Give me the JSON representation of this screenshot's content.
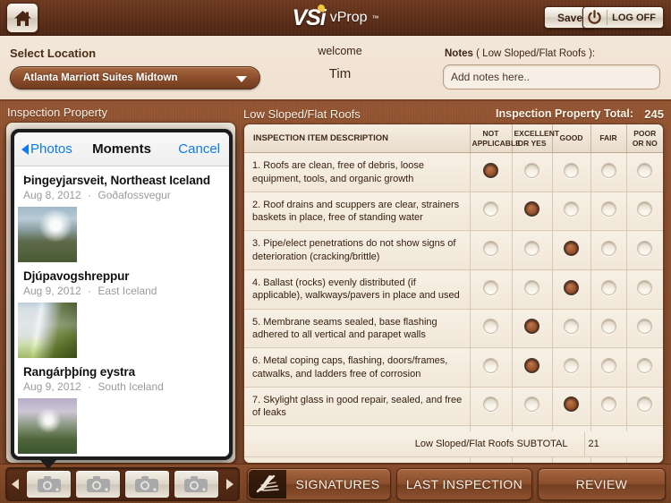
{
  "topbar": {
    "home_icon": "home-icon",
    "logo_primary": "VSi",
    "logo_secondary": "vProp",
    "logo_tm": "™",
    "save_label": "Save",
    "logoff_label": "LOG OFF",
    "power_icon": "power-icon"
  },
  "subbar": {
    "select_location_label": "Select Location",
    "location_value": "Atlanta Marriott Suites Midtown",
    "welcome_label": "welcome",
    "welcome_name": "Tim",
    "notes_label_prefix": "Notes",
    "notes_label_section": "( Low Sloped/Flat Roofs ):",
    "notes_placeholder": "Add notes here..",
    "notes_value": ""
  },
  "panels": {
    "left_title": "Inspection Property",
    "right_title": "Low Sloped/Flat Roofs",
    "total_label": "Inspection Property Total:",
    "total_value": "245"
  },
  "photo_picker": {
    "back_label": "Photos",
    "title": "Moments",
    "cancel_label": "Cancel",
    "moments": [
      {
        "title": "Þingeyjarsveit, Northeast Iceland",
        "date": "Aug 8, 2012",
        "place": "Goðafossvegur",
        "thumb": "waterfall1"
      },
      {
        "title": "Djúpavogshreppur",
        "date": "Aug 9, 2012",
        "place": "East Iceland",
        "thumb": "waterfall2"
      },
      {
        "title": "Rangárþþíng eystra",
        "date": "Aug 9, 2012",
        "place": "South Iceland",
        "thumb": "waterfall3"
      }
    ]
  },
  "table": {
    "headers": {
      "description": "INSPECTION ITEM DESCRIPTION",
      "columns": [
        "NOT APPLICABLE",
        "EXCELLENT OR YES",
        "GOOD",
        "FAIR",
        "POOR OR NO"
      ]
    },
    "rows": [
      {
        "text": "1. Roofs are clean, free of debris, loose equipment, tools, and organic growth",
        "selected": 0
      },
      {
        "text": "2. Roof drains and scuppers are clear, strainers baskets in place, free of standing water",
        "selected": 1
      },
      {
        "text": "3. Pipe/elect penetrations do not show signs of deterioration (cracking/brittle)",
        "selected": 2
      },
      {
        "text": "4. Ballast (rocks) evenly distributed (if applicable), walkways/pavers in place and used",
        "selected": 2
      },
      {
        "text": "5. Membrane seams sealed, base flashing adhered to all vertical and parapet walls",
        "selected": 1
      },
      {
        "text": "6. Metal coping caps, flashing, doors/frames, catwalks, and ladders free of corrosion",
        "selected": 1
      },
      {
        "text": "7. Skylight glass in good repair, sealed, and free of leaks",
        "selected": 2
      }
    ],
    "subtotal_label": "Low Sloped/Flat Roofs SUBTOTAL",
    "subtotal_value": "21"
  },
  "bottombar": {
    "prev_arrow_icon": "arrow-left-icon",
    "next_arrow_icon": "arrow-right-icon",
    "camera_icon": "camera-icon",
    "camera_slots": 4,
    "signatures_label": "SIGNATURES",
    "signature_icon": "pen-signature-icon",
    "last_inspection_label": "LAST INSPECTION",
    "review_label": "REVIEW"
  },
  "colors": {
    "brand_brown": "#7c4527",
    "dark_brown": "#5e2f19",
    "cream": "#f3e7d9",
    "accent_gold": "#f2c53d",
    "ios_blue": "#0b7bf1",
    "radio_selected": "#9c5630"
  }
}
